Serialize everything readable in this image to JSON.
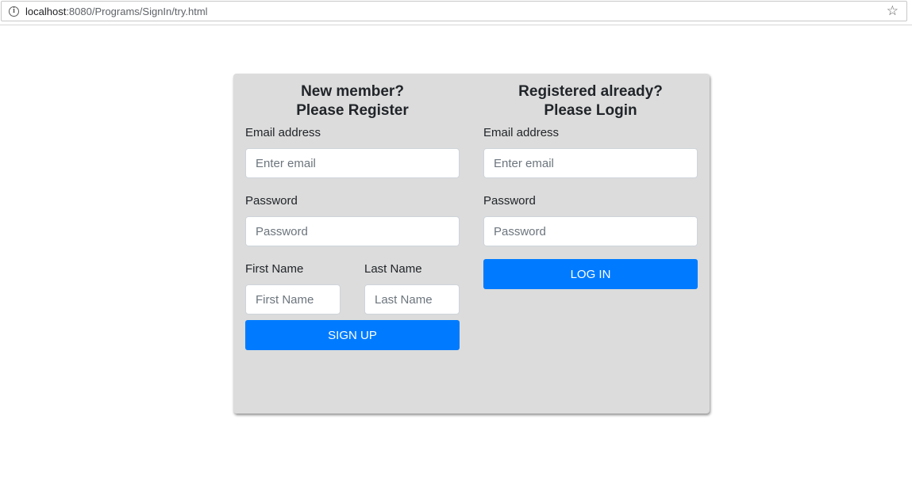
{
  "browser": {
    "url_host": "localhost",
    "url_path": ":8080/Programs/SignIn/try.html"
  },
  "register": {
    "heading_line1": "New member?",
    "heading_line2": "Please Register",
    "email_label": "Email address",
    "email_placeholder": "Enter email",
    "password_label": "Password",
    "password_placeholder": "Password",
    "first_name_label": "First Name",
    "first_name_placeholder": "First Name",
    "last_name_label": "Last Name",
    "last_name_placeholder": "Last Name",
    "button_label": "SIGN UP"
  },
  "login": {
    "heading_line1": "Registered already?",
    "heading_line2": "Please Login",
    "email_label": "Email address",
    "email_placeholder": "Enter email",
    "password_label": "Password",
    "password_placeholder": "Password",
    "button_label": "LOG IN"
  },
  "colors": {
    "card_background": "#dcdcdc",
    "button_primary": "#007bff"
  },
  "icons": {
    "info": "info-icon",
    "bookmark": "star-icon"
  }
}
